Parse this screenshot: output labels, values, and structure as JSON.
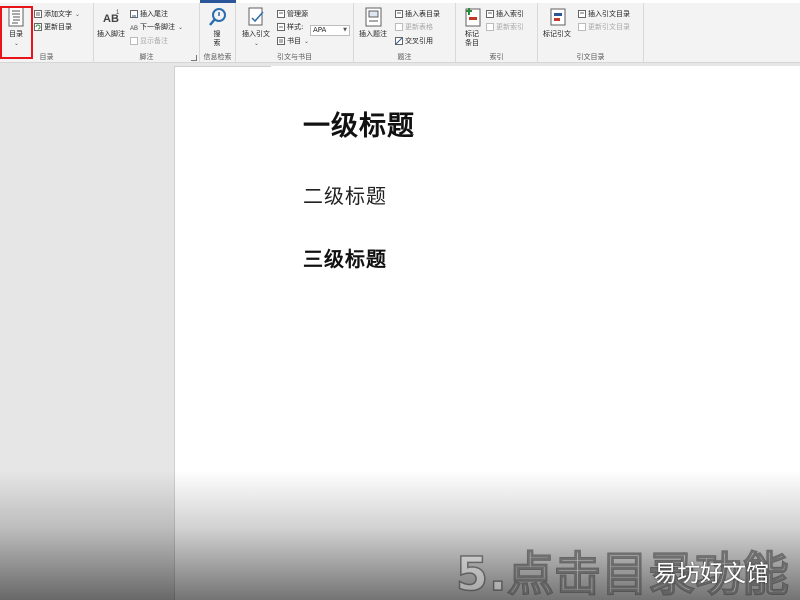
{
  "ribbon": {
    "toc_group": {
      "label": "目录",
      "toc_button": "目录",
      "add_text": "添加文字",
      "update_toc": "更新目录"
    },
    "footnotes_group": {
      "label": "脚注",
      "insert_footnote": "插入脚注",
      "insert_endnote": "插入尾注",
      "next_footnote": "下一条脚注",
      "show_notes": "显示备注"
    },
    "research_group": {
      "label": "信息检索",
      "search_line1": "搜",
      "search_line2": "索"
    },
    "citations_group": {
      "label": "引文与书目",
      "insert_citation": "插入引文",
      "manage_sources": "管理源",
      "style_label": "样式:",
      "style_value": "APA",
      "bibliography": "书目"
    },
    "captions_group": {
      "label": "题注",
      "insert_caption": "插入题注",
      "insert_table_of_figures": "插入表目录",
      "update_table": "更新表格",
      "cross_reference": "交叉引用"
    },
    "index_group": {
      "label": "索引",
      "mark_entry_line1": "标记",
      "mark_entry_line2": "条目",
      "insert_index": "插入索引",
      "update_index": "更新索引"
    },
    "table_of_authorities_group": {
      "label": "引文目录",
      "mark_citation": "标记引文",
      "insert_toa": "插入引文目录",
      "update_toa": "更新引文目录"
    }
  },
  "document": {
    "heading1": "一级标题",
    "heading2": "二级标题",
    "heading3": "三级标题"
  },
  "overlay": {
    "caption": "5.点击目录功能",
    "watermark": "易坊好文馆"
  },
  "colors": {
    "highlight_box": "#e8141a",
    "ribbon_bg": "#f3f3f3",
    "accent_tab": "#2b579a"
  }
}
